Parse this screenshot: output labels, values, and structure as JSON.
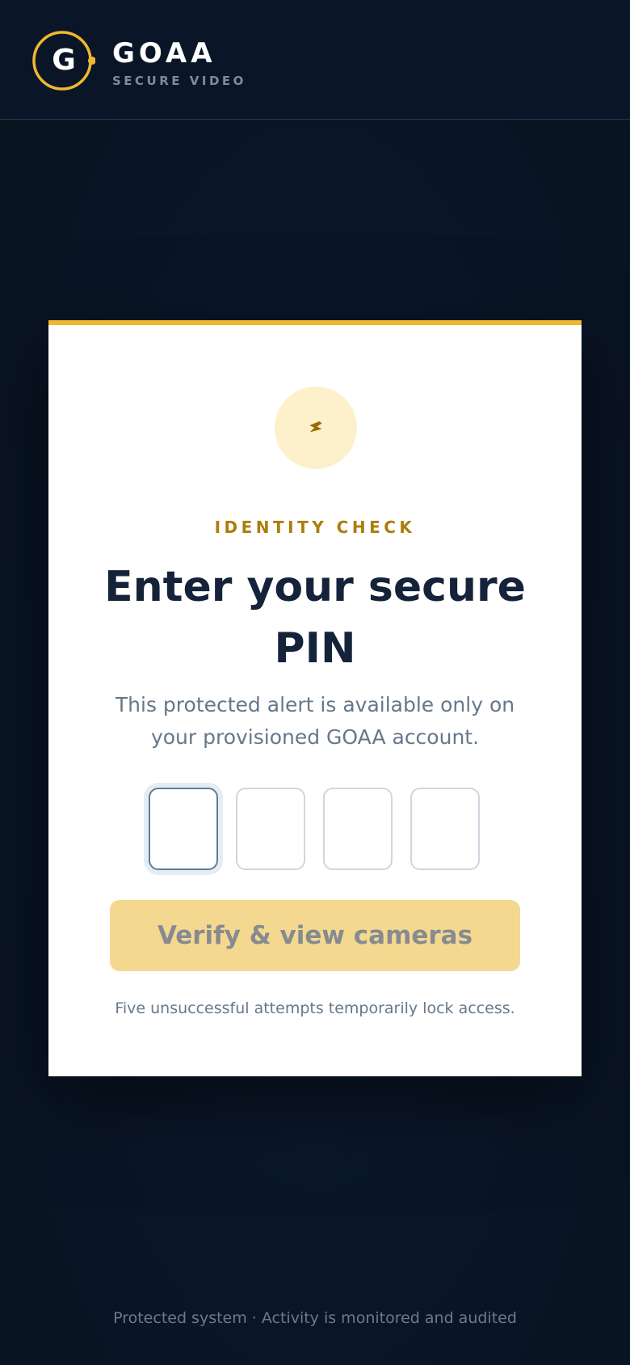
{
  "brand": {
    "logo_letter": "G",
    "name": "GOAA",
    "tagline": "SECURE VIDEO",
    "accent_color": "#f0b82e"
  },
  "card": {
    "badge_icon": "lightning-bolt-icon",
    "eyebrow": "IDENTITY CHECK",
    "title": "Enter your secure PIN",
    "subtitle": "This protected alert is available only on your provisioned GOAA account.",
    "pin": {
      "digits": [
        "",
        "",
        "",
        ""
      ],
      "active_index": 0
    },
    "verify_button_label": "Verify & view cameras",
    "lock_note": "Five unsuccessful attempts temporarily lock access."
  },
  "footer": {
    "text": "Protected system · Activity is monitored and audited"
  }
}
